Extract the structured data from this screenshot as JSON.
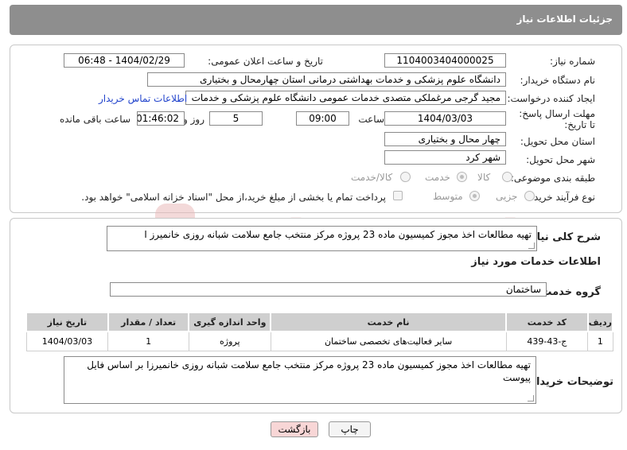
{
  "header": {
    "title": "جزئیات اطلاعات نیاز"
  },
  "labels": {
    "need_number": "شماره نیاز:",
    "announce_datetime": "تاریخ و ساعت اعلان عمومی:",
    "buyer_org": "نام دستگاه خریدار:",
    "requester": "ایجاد کننده درخواست:",
    "deadline": "مهلت ارسال پاسخ: تا تاریخ:",
    "time": "ساعت",
    "day_and": "روز و",
    "remaining": "ساعت باقی مانده",
    "province": "استان محل تحویل:",
    "city": "شهر محل تحویل:",
    "category": "طبقه بندی موضوعی:",
    "process": "نوع فرآیند خرید :",
    "description": "شرح کلی نیاز:",
    "services_info": "اطلاعات خدمات مورد نیاز",
    "service_group": "گروه خدمت:",
    "buyer_notes": "توضیحات خریدار:"
  },
  "values": {
    "need_number": "1104003404000025",
    "announce_datetime": "1404/02/29 - 06:48",
    "buyer_org": "دانشگاه علوم پزشکی و خدمات بهداشتی درمانی استان چهارمحال و بختیاری",
    "requester": "مجید گرجی مرغملکی متصدی خدمات عمومی دانشگاه علوم پزشکی و خدمات",
    "deadline_date": "1404/03/03",
    "deadline_time": "09:00",
    "days": "5",
    "remaining_time": "01:46:02",
    "province": "چهار محال و بختیاری",
    "city": "شهر کرد",
    "description": "تهیه مطالعات اخذ مجوز کمیسیون ماده 23 پروژه مرکز منتخب جامع سلامت شبانه روزی خانمیرز ا",
    "service_group": "ساختمان",
    "buyer_notes": "تهیه مطالعات اخذ مجوز کمیسیون ماده 23 پروژه مرکز منتخب جامع سلامت شبانه روزی خانمیرزا بر اساس فایل پیوست"
  },
  "contact_link": "اطلاعات تماس خریدار",
  "category_options": {
    "goods": "کالا",
    "service": "خدمت",
    "goods_service": "کالا/خدمت"
  },
  "process_options": {
    "partial": "جزیی",
    "medium": "متوسط",
    "treasury_note": "پرداخت تمام یا بخشی از مبلغ خرید،از محل \"اسناد خزانه اسلامی\" خواهد بود."
  },
  "table": {
    "headers": [
      "ردیف",
      "کد خدمت",
      "نام خدمت",
      "واحد اندازه گیری",
      "تعداد / مقدار",
      "تاریخ نیاز"
    ],
    "rows": [
      [
        "1",
        "ج-43-439",
        "سایر فعالیت‌های تخصصی ساختمان",
        "پروژه",
        "1",
        "1404/03/03"
      ]
    ]
  },
  "buttons": {
    "print": "چاپ",
    "back": "بازگشت"
  },
  "watermark": "AriaTender.neT",
  "colors": {
    "header_bg": "#8e8e8e",
    "link": "#2244cc",
    "back_button_bg": "#f8d6d6",
    "watermark": "#e9b9b9"
  }
}
